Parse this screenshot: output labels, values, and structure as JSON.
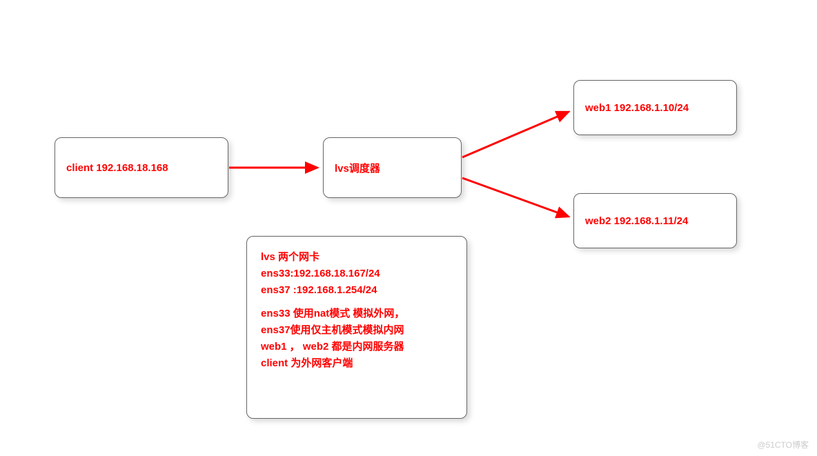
{
  "nodes": {
    "client": {
      "label": "client  192.168.18.168"
    },
    "lvs": {
      "label": "lvs调度器"
    },
    "web1": {
      "label": "web1  192.168.1.10/24"
    },
    "web2": {
      "label": "web2  192.168.1.11/24"
    }
  },
  "info": {
    "line1": "lvs 两个网卡",
    "line2": "ens33:192.168.18.167/24",
    "line3": "ens37 :192.168.1.254/24",
    "line4": "ens33 使用nat模式  模拟外网，",
    "line5": "ens37使用仅主机模式模拟内网",
    "line6": "web1 ， web2 都是内网服务器",
    "line7": "client 为外网客户端"
  },
  "watermark": "@51CTO博客",
  "colors": {
    "text": "#ff0000",
    "arrow": "#ff0000",
    "border": "#666666"
  }
}
